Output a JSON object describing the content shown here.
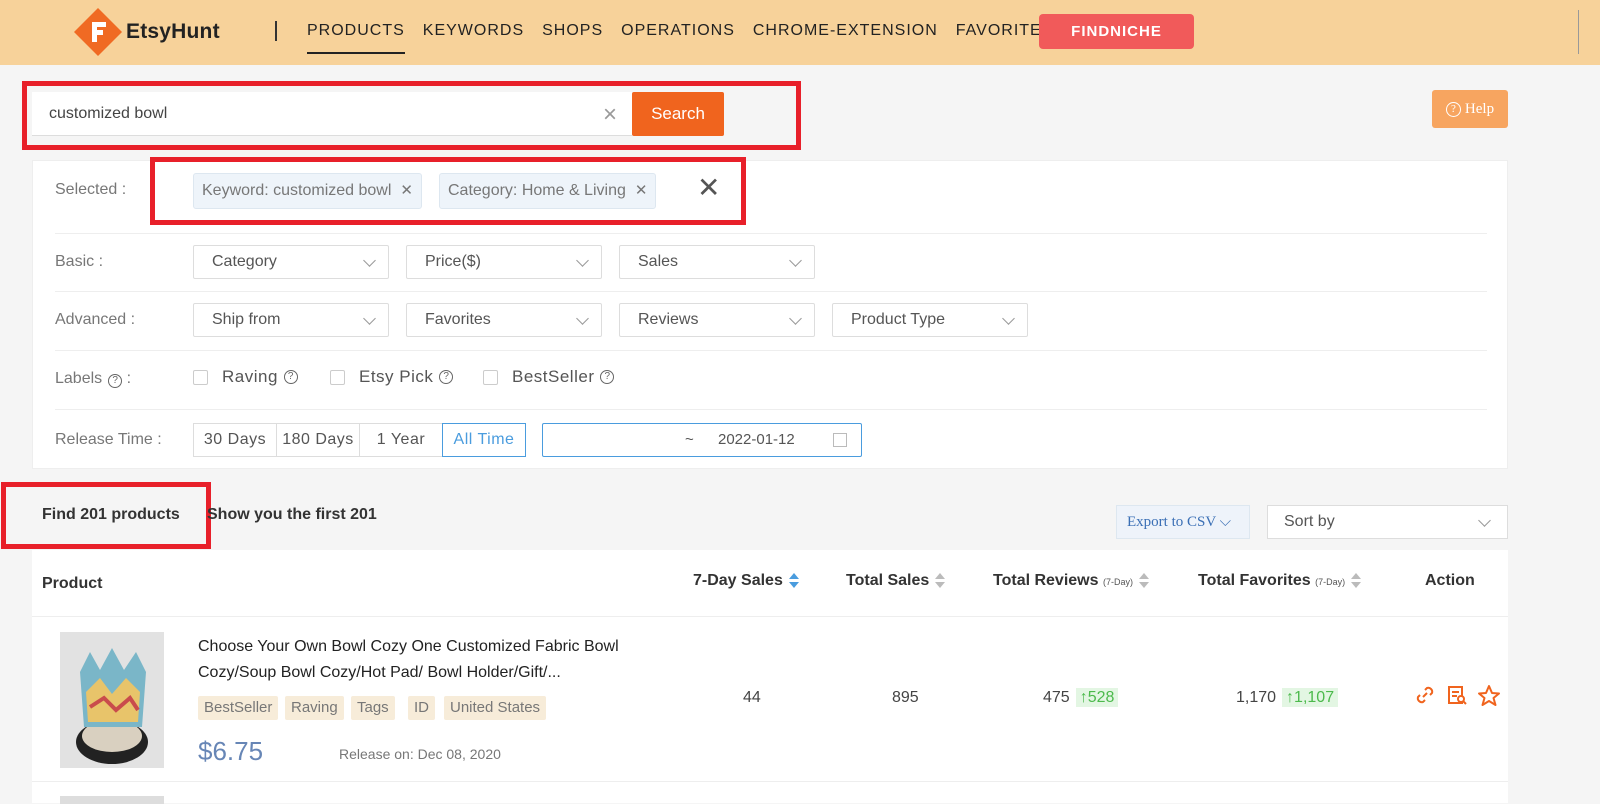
{
  "app": {
    "name": "EtsyHunt"
  },
  "nav": {
    "items": [
      "PRODUCTS",
      "KEYWORDS",
      "SHOPS",
      "OPERATIONS",
      "CHROME-EXTENSION",
      "FAVORITES"
    ],
    "active": "PRODUCTS",
    "cta": "FINDNICHE"
  },
  "search": {
    "value": "customized bowl",
    "button": "Search"
  },
  "help": {
    "label": "Help"
  },
  "filters": {
    "selected_label": "Selected :",
    "chips": [
      "Keyword: customized bowl",
      "Category: Home & Living"
    ],
    "basic_label": "Basic :",
    "basic": [
      "Category",
      "Price($)",
      "Sales"
    ],
    "advanced_label": "Advanced :",
    "advanced": [
      "Ship from",
      "Favorites",
      "Reviews",
      "Product Type"
    ],
    "labels_label": "Labels",
    "labels_colon": ":",
    "labels": [
      "Raving",
      "Etsy Pick",
      "BestSeller"
    ],
    "release_label": "Release Time :",
    "release_options": [
      "30 Days",
      "180 Days",
      "1 Year",
      "All Time"
    ],
    "release_active": "All Time",
    "date_sep": "~",
    "date_end": "2022-01-12"
  },
  "results": {
    "found": "Find 201 products",
    "shown": "Show you the first 201",
    "export": "Export to CSV",
    "sort": "Sort by"
  },
  "table": {
    "headers": {
      "product": "Product",
      "sales7": "7-Day Sales",
      "total_sales": "Total Sales",
      "total_reviews": "Total Reviews",
      "total_favorites": "Total Favorites",
      "seven_day": "(7-Day)",
      "action": "Action"
    },
    "rows": [
      {
        "title": "Choose Your Own Bowl Cozy One Customized Fabric Bowl Cozy/Soup Bowl Cozy/Hot Pad/ Bowl Holder/Gift/...",
        "tags": [
          "BestSeller",
          "Raving",
          "Tags",
          "ID",
          "United States"
        ],
        "price": "$6.75",
        "release": "Release on: Dec 08, 2020",
        "sales7": "44",
        "total_sales": "895",
        "reviews": "475",
        "reviews_trend": "↑528",
        "favorites": "1,170",
        "favorites_trend": "↑1,107"
      }
    ]
  },
  "colors": {
    "brand_bar": "#f7d29a",
    "accent": "#f0641e",
    "cta": "#f15a5a",
    "highlight": "#e8202a",
    "link": "#4a9cde"
  }
}
